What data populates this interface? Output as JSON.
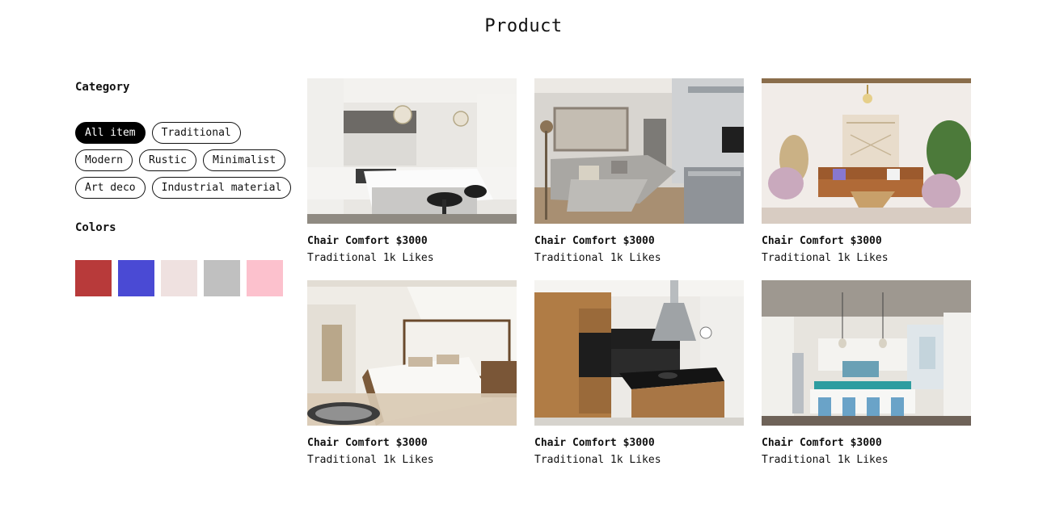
{
  "page": {
    "title": "Product"
  },
  "sidebar": {
    "category_heading": "Category",
    "categories": [
      {
        "label": "All item",
        "active": true
      },
      {
        "label": "Traditional",
        "active": false
      },
      {
        "label": "Modern",
        "active": false
      },
      {
        "label": "Rustic",
        "active": false
      },
      {
        "label": "Minimalist",
        "active": false
      },
      {
        "label": "Art deco",
        "active": false
      },
      {
        "label": "Industrial material",
        "active": false
      }
    ],
    "colors_heading": "Colors",
    "colors": [
      "#b83a3a",
      "#4a4ad4",
      "#efe1e0",
      "#c0c0c0",
      "#fcc1cd"
    ]
  },
  "products": [
    {
      "name": "Chair Comfort",
      "price": "$3000",
      "title": "Chair Comfort $3000",
      "meta": "Traditional 1k Likes",
      "image": "white-kitchen-photo"
    },
    {
      "name": "Chair Comfort",
      "price": "$3000",
      "title": "Chair Comfort $3000",
      "meta": "Traditional 1k Likes",
      "image": "grey-sofa-living-room-photo"
    },
    {
      "name": "Chair Comfort",
      "price": "$3000",
      "title": "Chair Comfort $3000",
      "meta": "Traditional 1k Likes",
      "image": "boho-living-room-photo"
    },
    {
      "name": "Chair Comfort",
      "price": "$3000",
      "title": "Chair Comfort $3000",
      "meta": "Traditional 1k Likes",
      "image": "white-bedroom-photo"
    },
    {
      "name": "Chair Comfort",
      "price": "$3000",
      "title": "Chair Comfort $3000",
      "meta": "Traditional 1k Likes",
      "image": "wood-kitchen-island-photo"
    },
    {
      "name": "Chair Comfort",
      "price": "$3000",
      "title": "Chair Comfort $3000",
      "meta": "Traditional 1k Likes",
      "image": "kitchen-dining-photo"
    }
  ]
}
